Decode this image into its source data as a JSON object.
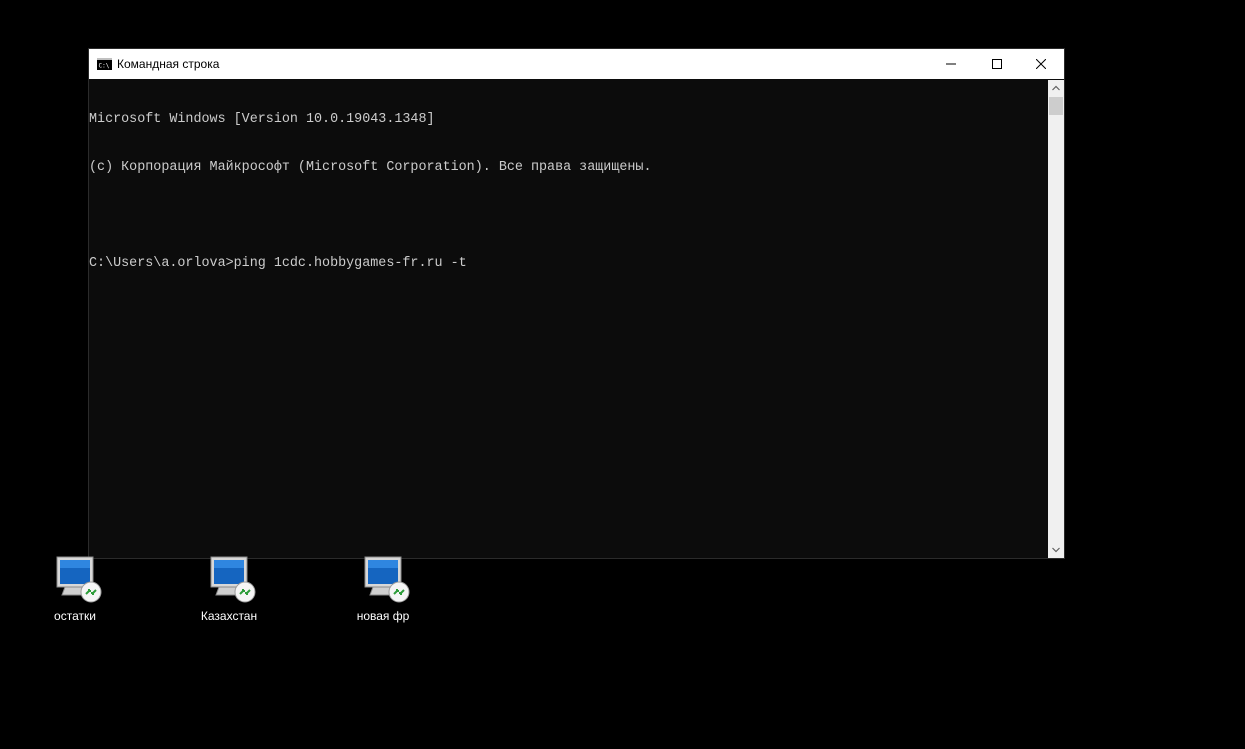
{
  "window": {
    "title": "Командная строка",
    "icon": "cmd-icon"
  },
  "console": {
    "lines": [
      "Microsoft Windows [Version 10.0.19043.1348]",
      "(c) Корпорация Майкрософт (Microsoft Corporation). Все права защищены.",
      "",
      "C:\\Users\\a.orlova>ping 1cdc.hobbygames-fr.ru -t"
    ]
  },
  "desktop_icons": [
    {
      "label": "остатки",
      "icon": "remote-desktop-icon"
    },
    {
      "label": "Казахстан",
      "icon": "remote-desktop-icon"
    },
    {
      "label": "новая фр",
      "icon": "remote-desktop-icon"
    }
  ],
  "colors": {
    "desktop_bg": "#000000",
    "console_bg": "#0c0c0c",
    "console_text": "#cccccc",
    "titlebar_bg": "#ffffff"
  }
}
